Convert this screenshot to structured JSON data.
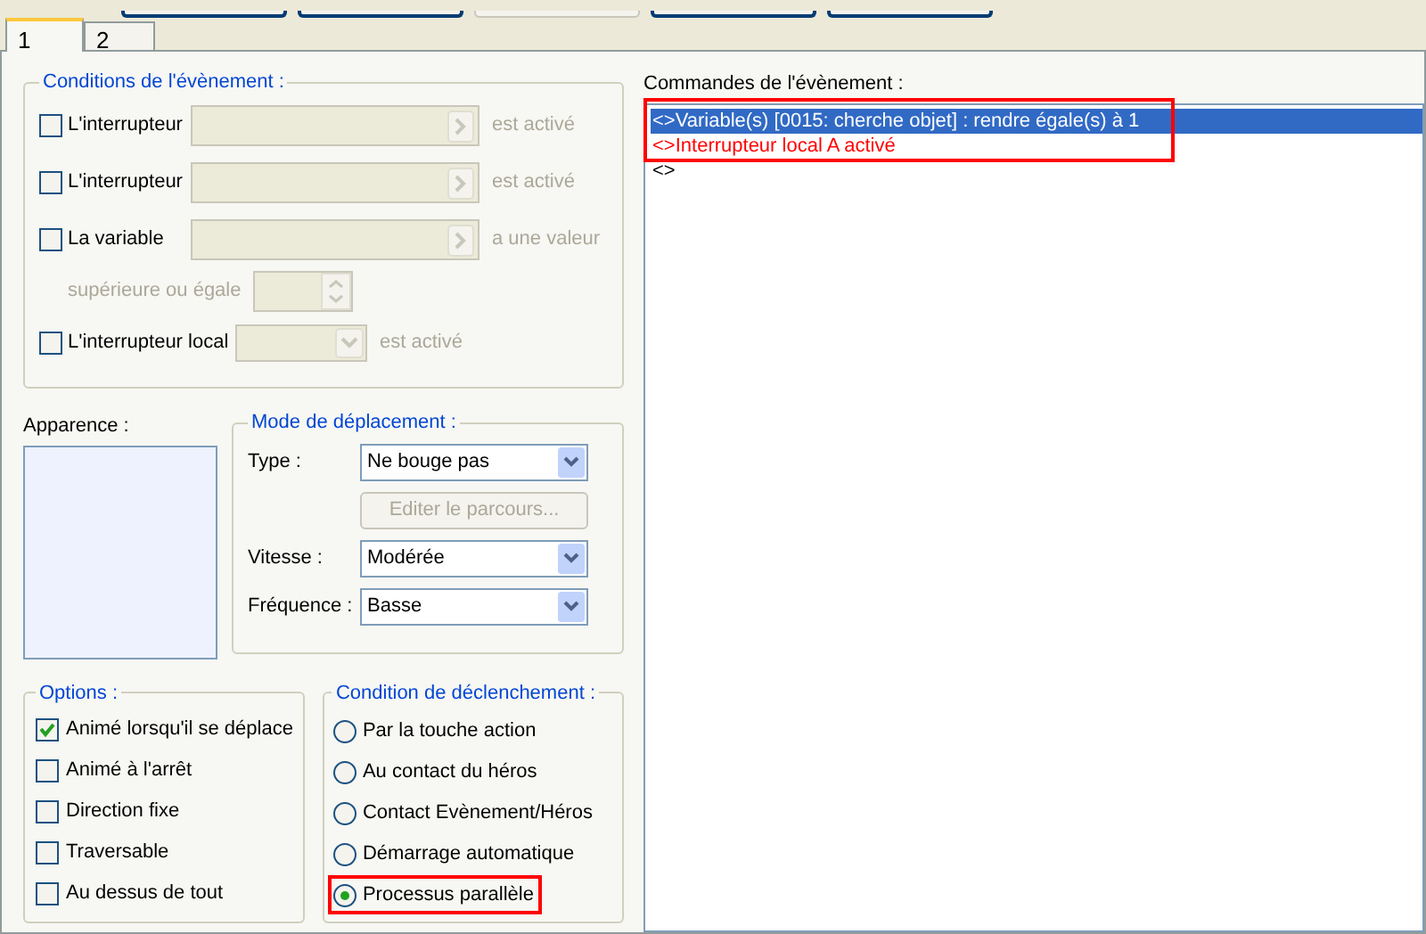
{
  "tabs": [
    {
      "label": "1",
      "selected": true
    },
    {
      "label": "2",
      "selected": false
    }
  ],
  "top_buttons": [
    {
      "disabled": false
    },
    {
      "disabled": false
    },
    {
      "disabled": true
    },
    {
      "disabled": false
    },
    {
      "disabled": false
    }
  ],
  "conditions": {
    "title": "Conditions de l'évènement :",
    "rows": [
      {
        "kind": "picker",
        "label": "L'interrupteur",
        "checked": false,
        "suffix": "est activé"
      },
      {
        "kind": "picker",
        "label": "L'interrupteur",
        "checked": false,
        "suffix": "est activé"
      },
      {
        "kind": "picker",
        "label": "La variable",
        "checked": false,
        "suffix": "a une valeur"
      },
      {
        "kind": "spinner",
        "label": "supérieure ou égale"
      },
      {
        "kind": "combo",
        "label": "L'interrupteur local",
        "checked": false,
        "suffix": "est activé"
      }
    ]
  },
  "appearance": {
    "label": "Apparence :"
  },
  "movement": {
    "title": "Mode de déplacement :",
    "rows": [
      {
        "kind": "select",
        "label": "Type :",
        "value": "Ne bouge pas"
      },
      {
        "kind": "button",
        "label": "Editer le parcours...",
        "disabled": true
      },
      {
        "kind": "select",
        "label": "Vitesse :",
        "value": "Modérée"
      },
      {
        "kind": "select",
        "label": "Fréquence :",
        "value": "Basse"
      }
    ]
  },
  "options": {
    "title": "Options :",
    "items": [
      {
        "label": "Animé lorsqu'il se déplace",
        "checked": true
      },
      {
        "label": "Animé à l'arrêt",
        "checked": false
      },
      {
        "label": "Direction fixe",
        "checked": false
      },
      {
        "label": "Traversable",
        "checked": false
      },
      {
        "label": "Au dessus de tout",
        "checked": false
      }
    ]
  },
  "trigger": {
    "title": "Condition de déclenchement :",
    "items": [
      {
        "label": "Par la touche action",
        "selected": false,
        "highlighted": false
      },
      {
        "label": "Au contact du héros",
        "selected": false,
        "highlighted": false
      },
      {
        "label": "Contact Evènement/Héros",
        "selected": false,
        "highlighted": false
      },
      {
        "label": "Démarrage automatique",
        "selected": false,
        "highlighted": false
      },
      {
        "label": "Processus parallèle",
        "selected": true,
        "highlighted": true
      }
    ]
  },
  "commands": {
    "label": "Commandes de l'évènement :",
    "highlighted": true,
    "items": [
      {
        "text": "<>Variable(s) [0015: cherche objet] : rendre égale(s) à 1",
        "selected": true
      },
      {
        "text": "<>Interrupteur local A activé",
        "selected": false,
        "color": "#ff0000"
      },
      {
        "text": "<>",
        "selected": false
      }
    ]
  }
}
